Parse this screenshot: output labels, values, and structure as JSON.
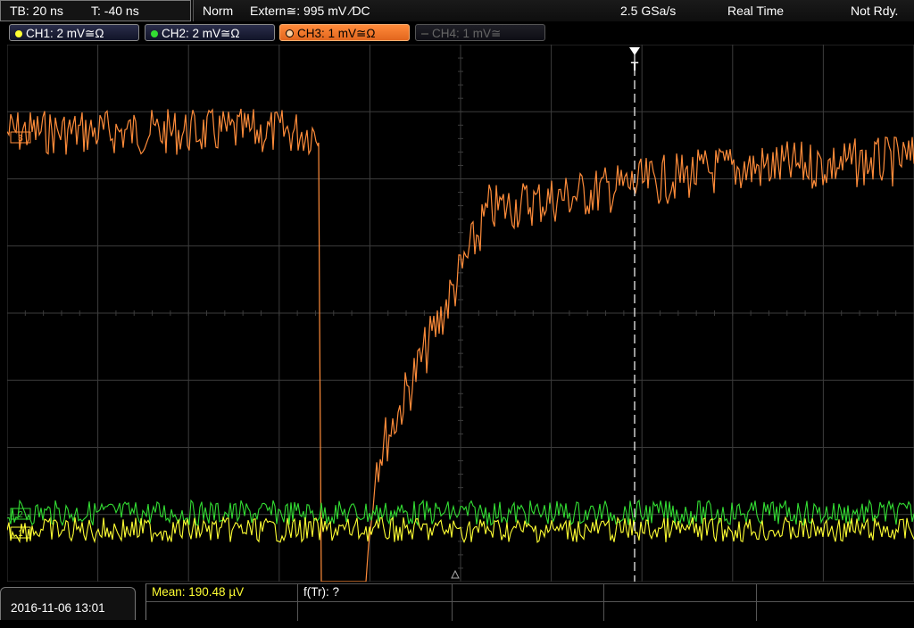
{
  "timebase": {
    "tb": "TB: 20 ns",
    "trigger_pos": "T: -40 ns"
  },
  "acquisition": {
    "mode": "Norm",
    "trigger": "Extern≅: 995 mV ⁄DC",
    "sample_rate": "2.5 GSa/s",
    "acq_mode": "Real Time",
    "status": "Not Rdy."
  },
  "channels": [
    {
      "label": "CH1: 2 mV≅Ω",
      "color": "#ffff33",
      "active": false,
      "enabled": true
    },
    {
      "label": "CH2: 2 mV≅Ω",
      "color": "#33dd33",
      "active": false,
      "enabled": true
    },
    {
      "label": "CH3: 1 mV≅Ω",
      "color": "#ff8c3a",
      "active": true,
      "enabled": true
    },
    {
      "label": "CH4: 1 mV≅",
      "color": "#666666",
      "active": false,
      "enabled": false
    }
  ],
  "markers": {
    "trigger": "T",
    "ch3": "3",
    "ch2": "2",
    "ch1": "1"
  },
  "datetime": "2016-11-06 13:01",
  "measurements": {
    "mean": "Mean: 190.48 µV",
    "ftr": "f(Tr): ?"
  },
  "colors": {
    "grid": "#3c3c3c",
    "ch1": "#ffff33",
    "ch2": "#33dd33",
    "ch3": "#ff8c3a",
    "meas_text": "#ffff33"
  }
}
